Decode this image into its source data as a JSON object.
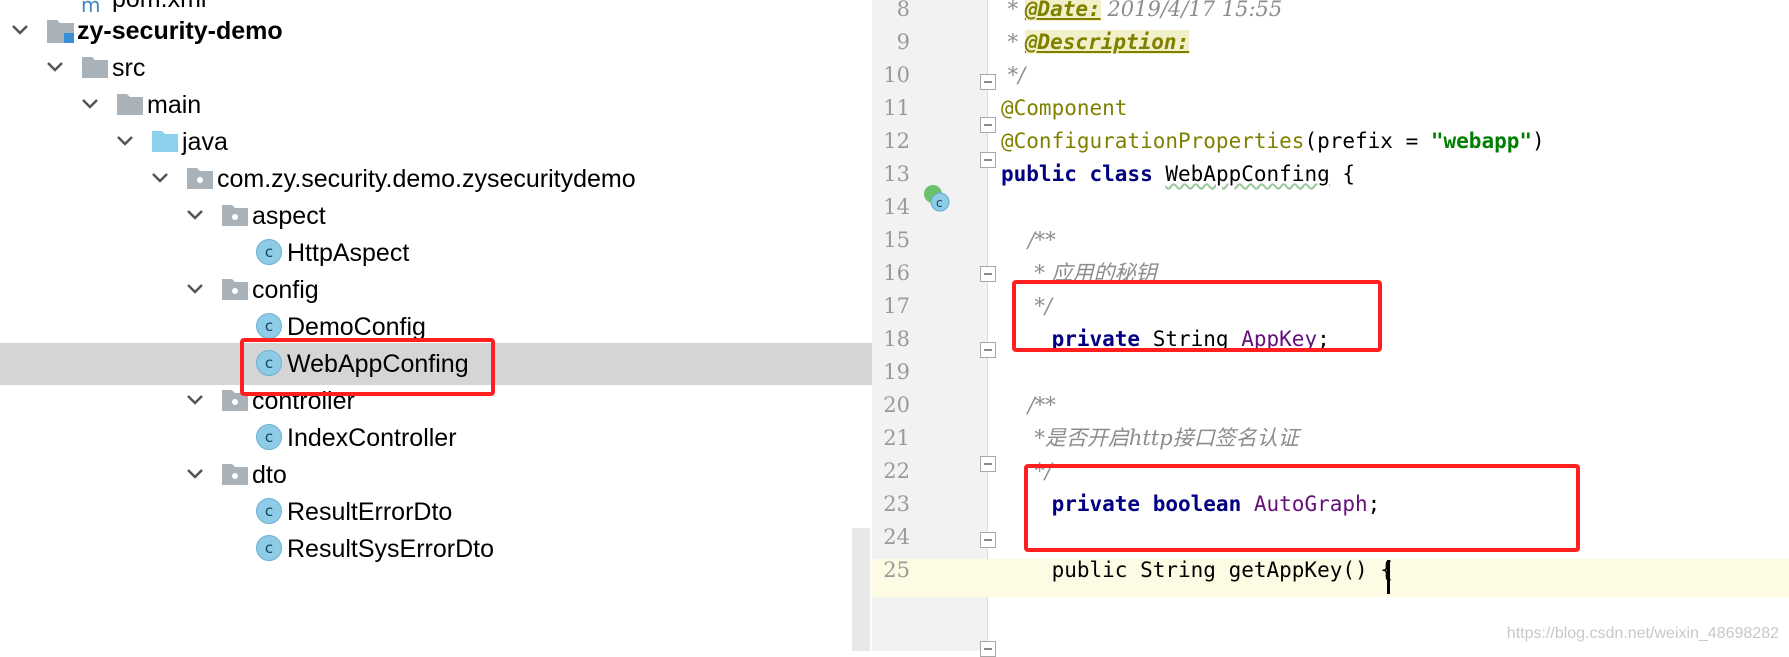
{
  "project_tree": {
    "partial_top_item": "pom.xml",
    "items": [
      {
        "label": "zy-security-demo",
        "type": "module",
        "bold": true
      },
      {
        "label": "src",
        "type": "folder"
      },
      {
        "label": "main",
        "type": "folder"
      },
      {
        "label": "java",
        "type": "source-folder"
      },
      {
        "label": "com.zy.security.demo.zysecuritydemo",
        "type": "package"
      },
      {
        "label": "aspect",
        "type": "package"
      },
      {
        "label": "HttpAspect",
        "type": "class"
      },
      {
        "label": "config",
        "type": "package"
      },
      {
        "label": "DemoConfig",
        "type": "class"
      },
      {
        "label": "WebAppConfing",
        "type": "class",
        "selected": true
      },
      {
        "label": "controller",
        "type": "package"
      },
      {
        "label": "IndexController",
        "type": "class"
      },
      {
        "label": "dto",
        "type": "package"
      },
      {
        "label": "ResultErrorDto",
        "type": "class"
      },
      {
        "label": "ResultSysErrorDto",
        "type": "class"
      }
    ],
    "class_icon_letter": "c"
  },
  "editor": {
    "line_numbers": [
      "8",
      "9",
      "10",
      "11",
      "12",
      "13",
      "14",
      "15",
      "16",
      "17",
      "18",
      "19",
      "20",
      "21",
      "22",
      "23",
      "24",
      "25"
    ],
    "lines": {
      "l8_star": " * ",
      "l8_tag": "@Date:",
      "l8_val": " 2019/4/17 15:55",
      "l9_star": " * ",
      "l9_tag": "@Description:",
      "l10": " */",
      "l11": "@Component",
      "l12_ann": "@ConfigurationProperties",
      "l12_a": "(prefix = ",
      "l12_str": "\"webapp\"",
      "l12_b": ")",
      "l13_kw": "public class ",
      "l13_name": "WebAppConfing",
      "l13_rest": " {",
      "l15": "    /**",
      "l16": "     * 应用的秘钥",
      "l17": "     */",
      "l18_kw": "    private ",
      "l18_type": "String ",
      "l18_fld": "AppKey",
      "l18_end": ";",
      "l20": "    /**",
      "l21": "     *是否开启http接口签名认证",
      "l22": "     */",
      "l23_kw": "    private boolean ",
      "l23_fld": "AutoGraph",
      "l23_end": ";",
      "l25": "    public String getAppKey() {"
    }
  },
  "watermark": "https://blog.csdn.net/weixin_48698282",
  "colors": {
    "highlight_box": "#ff1f1f",
    "selected_row": "#d5d5d5",
    "keyword": "#000080",
    "annotation": "#808000",
    "string": "#008000",
    "field": "#660e7a",
    "comment": "#8c8c8c"
  }
}
